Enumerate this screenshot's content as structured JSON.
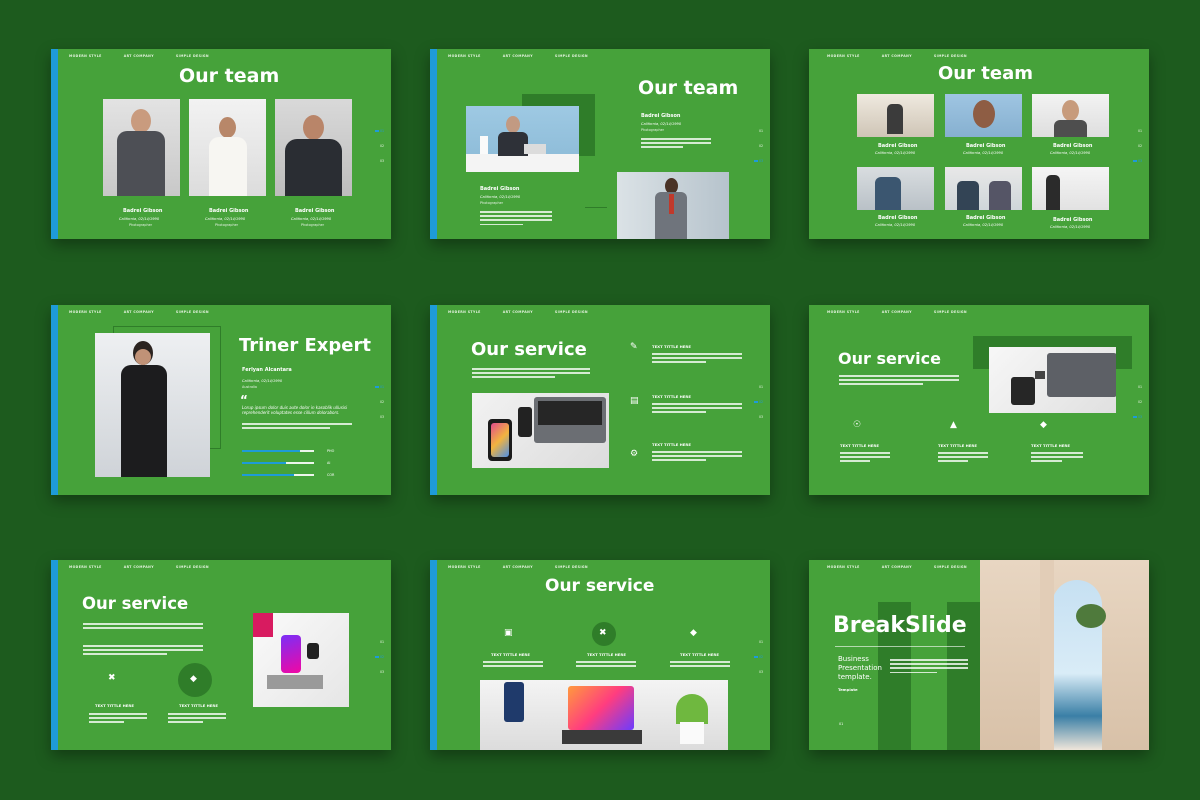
{
  "colors": {
    "background": "#1d5b1e",
    "slide": "#46a23a",
    "accent": "#1e9bd8",
    "dark": "#2f7d29"
  },
  "nav": {
    "item1": "MODERN STYLE",
    "item2": "ART COMPANY",
    "item3": "SIMPLE DESIGN"
  },
  "titles": {
    "our_team": "Our team",
    "triner_expert": "Triner Expert",
    "our_service": "Our service",
    "breakslide": "BreakSlide"
  },
  "person": {
    "name": "Badrei Gibson",
    "location": "California, 02/14/1990",
    "role": "Photographer"
  },
  "expert": {
    "name": "Ferlyan Alcantara",
    "location": "California, 02/14/1990",
    "role": "Australia",
    "quote_mark": "“",
    "quote": "Lorup ipsum dolor duis aute dolor in kasoblik ullusisi reprehenderit voluptates esse cillum dolorabors.",
    "skills": [
      "PHO",
      "AI",
      "COR"
    ]
  },
  "service": {
    "item_title": "TEXT TITTLE HERE"
  },
  "breakslide": {
    "subtitle_line1": "Business",
    "subtitle_line2": "Presentation",
    "subtitle_line3": "template.",
    "label": "Template"
  },
  "pager": {
    "p1": "01",
    "p2": "02",
    "p3": "03"
  }
}
